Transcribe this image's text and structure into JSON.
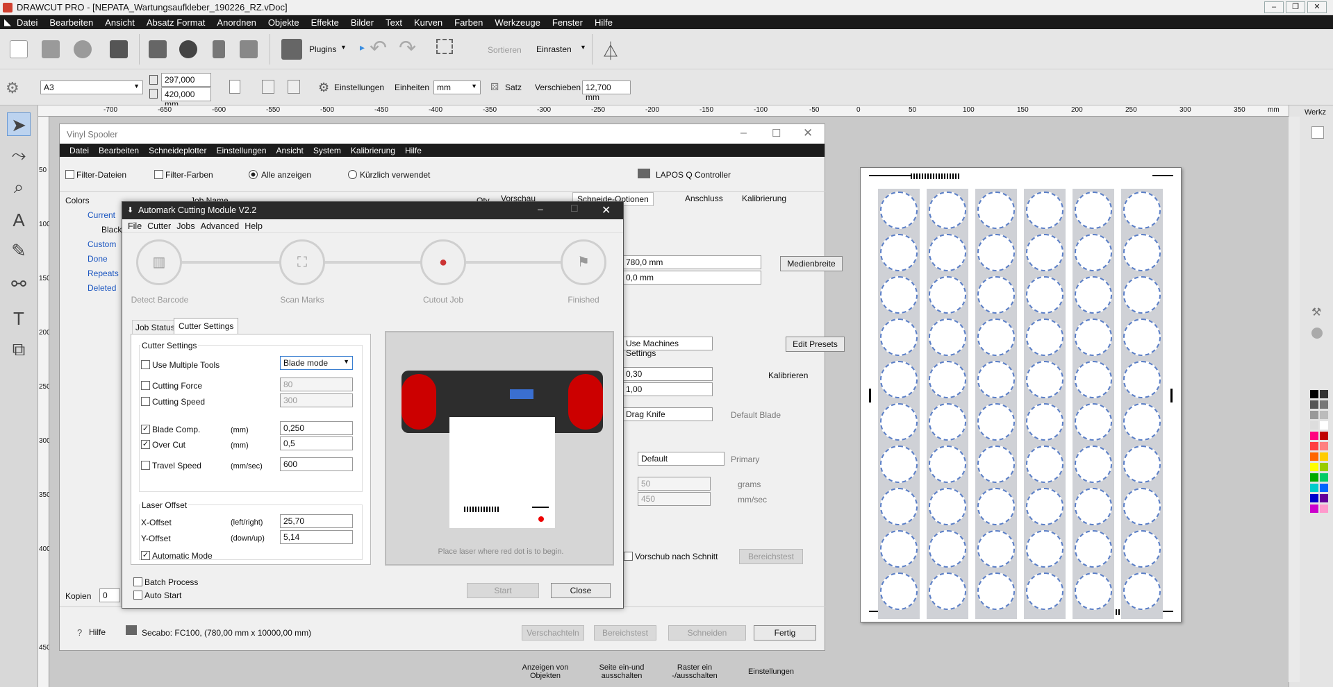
{
  "app": {
    "title": "DRAWCUT PRO - [NEPATA_Wartungsaufkleber_190226_RZ.vDoc]"
  },
  "menu": [
    "Datei",
    "Bearbeiten",
    "Ansicht",
    "Absatz Format",
    "Anordnen",
    "Objekte",
    "Effekte",
    "Bilder",
    "Text",
    "Kurven",
    "Farben",
    "Werkzeuge",
    "Fenster",
    "Hilfe"
  ],
  "toolbar": {
    "plugins": "Plugins",
    "sortieren": "Sortieren",
    "einrasten": "Einrasten",
    "page_size": "A3",
    "width": "297,000 mm",
    "height": "420,000 mm",
    "einstellungen": "Einstellungen",
    "einheiten_label": "Einheiten",
    "einheiten": "mm",
    "satz": "Satz",
    "verschieben_label": "Verschieben",
    "verschieben": "12,700 mm"
  },
  "ruler": {
    "top": [
      "-700",
      "-650",
      "-600",
      "-550",
      "-500",
      "-450",
      "-400",
      "-350",
      "-300",
      "-250",
      "-200",
      "-150",
      "-100",
      "-50",
      "0",
      "50",
      "100",
      "150",
      "200",
      "250",
      "300",
      "350",
      "mm"
    ],
    "left": [
      "50",
      "100",
      "150",
      "200",
      "250",
      "300",
      "350",
      "400",
      "450"
    ]
  },
  "rightpanel": {
    "label": "Werkz"
  },
  "spooler": {
    "title": "Vinyl Spooler",
    "menu": [
      "Datei",
      "Bearbeiten",
      "Schneideplotter",
      "Einstellungen",
      "Ansicht",
      "System",
      "Kalibrierung",
      "Hilfe"
    ],
    "filter_dateien": "Filter-Dateien",
    "filter_farben": "Filter-Farben",
    "alle": "Alle anzeigen",
    "kuerzlich": "Kürzlich verwendet",
    "lapos": "LAPOS Q Controller",
    "colors": "Colors",
    "job_name": "Job Name",
    "qty": "Qty",
    "tree": [
      "Current",
      "Black",
      "Custom",
      "Done",
      "Repeats",
      "Deleted"
    ],
    "tabs": [
      "Vorschau",
      "Schneide-Optionen",
      "Anschluss",
      "Kalibrierung"
    ],
    "val_780": "780,0 mm",
    "val_0": "0,0 mm",
    "medienbreite": "Medienbreite",
    "use_machines": "Use Machines Settings",
    "edit_presets": "Edit Presets",
    "v030": "0,30",
    "v100": "1,00",
    "kalibrieren": "Kalibrieren",
    "drag_knife": "Drag Knife",
    "default_blade": "Default Blade",
    "default": "Default",
    "primary": "Primary",
    "v50": "50",
    "grams": "grams",
    "v450": "450",
    "mmsec": "mm/sec",
    "vorschub": "Vorschub nach Schnitt",
    "bereichstest": "Bereichstest",
    "kopien": "Kopien",
    "kopien_val": "0",
    "hilfe": "Hilfe",
    "device": "Secabo: FC100,  (780,00 mm x 10000,00 mm)",
    "verschachteln": "Verschachteln",
    "bereichstest2": "Bereichstest",
    "schneiden": "Schneiden",
    "fertig": "Fertig"
  },
  "automark": {
    "title": "Automark Cutting Module V2.2",
    "menu": [
      "File",
      "Cutter",
      "Jobs",
      "Advanced",
      "Help"
    ],
    "steps": [
      "Detect Barcode",
      "Scan Marks",
      "Cutout Job",
      "Finished"
    ],
    "tabs": [
      "Job Status",
      "Cutter Settings"
    ],
    "group1": "Cutter Settings",
    "use_multiple": "Use Multiple Tools",
    "blade_mode": "Blade mode",
    "cutting_force": "Cutting Force",
    "cf_val": "80",
    "cutting_speed": "Cutting Speed",
    "cs_val": "300",
    "blade_comp": "Blade Comp.",
    "bc_unit": "(mm)",
    "bc_val": "0,250",
    "over_cut": "Over Cut",
    "oc_unit": "(mm)",
    "oc_val": "0,5",
    "travel_speed": "Travel Speed",
    "ts_unit": "(mm/sec)",
    "ts_val": "600",
    "group2": "Laser Offset",
    "x_offset": "X-Offset",
    "x_unit": "(left/right)",
    "x_val": "25,70",
    "y_offset": "Y-Offset",
    "y_unit": "(down/up)",
    "y_val": "5,14",
    "auto_mode": "Automatic Mode",
    "hint": "Place laser where red dot is to begin.",
    "batch": "Batch Process",
    "auto_start": "Auto Start",
    "start": "Start",
    "close": "Close"
  },
  "bottombar": [
    "Anzeigen von Objekten",
    "Seite ein-und ausschalten",
    "Raster ein -/ausschalten",
    "Einstellungen"
  ],
  "palette": [
    "#000000",
    "#333333",
    "#555555",
    "#777777",
    "#999999",
    "#bbbbbb",
    "#dddddd",
    "#ffffff",
    "#ff0080",
    "#c00000",
    "#ff4040",
    "#ff8080",
    "#ff6600",
    "#ffcc00",
    "#ffff00",
    "#99cc00",
    "#00aa00",
    "#00cc66",
    "#00cccc",
    "#0066ff",
    "#0000cc",
    "#660099",
    "#cc00cc",
    "#ff99cc"
  ]
}
